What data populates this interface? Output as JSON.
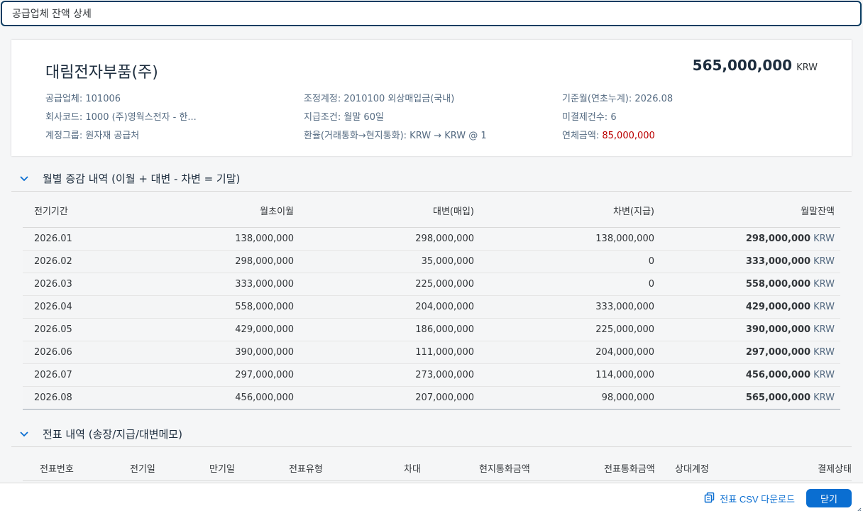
{
  "dialog": {
    "title": "공급업체 잔액 상세"
  },
  "header": {
    "supplier_name": "대림전자부품(주)",
    "balance_amount": "565,000,000",
    "balance_currency": "KRW",
    "col1": [
      {
        "label": "공급업체:",
        "value": "101006"
      },
      {
        "label": "회사코드:",
        "value": "1000 (주)영웍스전자 - 한..."
      },
      {
        "label": "계정그룹:",
        "value": "원자재 공급처"
      }
    ],
    "col2": [
      {
        "label": "조정계정:",
        "value": "2010100 외상매입금(국내)"
      },
      {
        "label": "지급조건:",
        "value": "월말 60일"
      },
      {
        "label": "환율(거래통화→현지통화):",
        "value": "KRW → KRW @ 1"
      }
    ],
    "col3": [
      {
        "label": "기준월(연초누계):",
        "value": "2026.08"
      },
      {
        "label": "미결제건수:",
        "value": "6"
      },
      {
        "label": "연체금액:",
        "value": "85,000,000"
      }
    ]
  },
  "monthly": {
    "title": "월별 증감 내역 (이월 + 대변 - 차변 = 기말)",
    "columns": [
      "전기기간",
      "월초이월",
      "대변(매입)",
      "차변(지급)",
      "월말잔액"
    ],
    "currency": "KRW",
    "rows": [
      {
        "period": "2026.01",
        "opening": "138,000,000",
        "credit": "298,000,000",
        "debit": "138,000,000",
        "closing": "298,000,000"
      },
      {
        "period": "2026.02",
        "opening": "298,000,000",
        "credit": "35,000,000",
        "debit": "0",
        "closing": "333,000,000"
      },
      {
        "period": "2026.03",
        "opening": "333,000,000",
        "credit": "225,000,000",
        "debit": "0",
        "closing": "558,000,000"
      },
      {
        "period": "2026.04",
        "opening": "558,000,000",
        "credit": "204,000,000",
        "debit": "333,000,000",
        "closing": "429,000,000"
      },
      {
        "period": "2026.05",
        "opening": "429,000,000",
        "credit": "186,000,000",
        "debit": "225,000,000",
        "closing": "390,000,000"
      },
      {
        "period": "2026.06",
        "opening": "390,000,000",
        "credit": "111,000,000",
        "debit": "204,000,000",
        "closing": "297,000,000"
      },
      {
        "period": "2026.07",
        "opening": "297,000,000",
        "credit": "273,000,000",
        "debit": "114,000,000",
        "closing": "456,000,000"
      },
      {
        "period": "2026.08",
        "opening": "456,000,000",
        "credit": "207,000,000",
        "debit": "98,000,000",
        "closing": "565,000,000"
      }
    ]
  },
  "documents": {
    "title": "전표 내역 (송장/지급/대변메모)",
    "columns": [
      "전표번호",
      "전기일",
      "만기일",
      "전표유형",
      "차대",
      "현지통화금액",
      "전표통화금액",
      "상대계정",
      "결제상태"
    ]
  },
  "footer": {
    "csv_label": "전표 CSV 다운로드",
    "close_label": "닫기"
  }
}
